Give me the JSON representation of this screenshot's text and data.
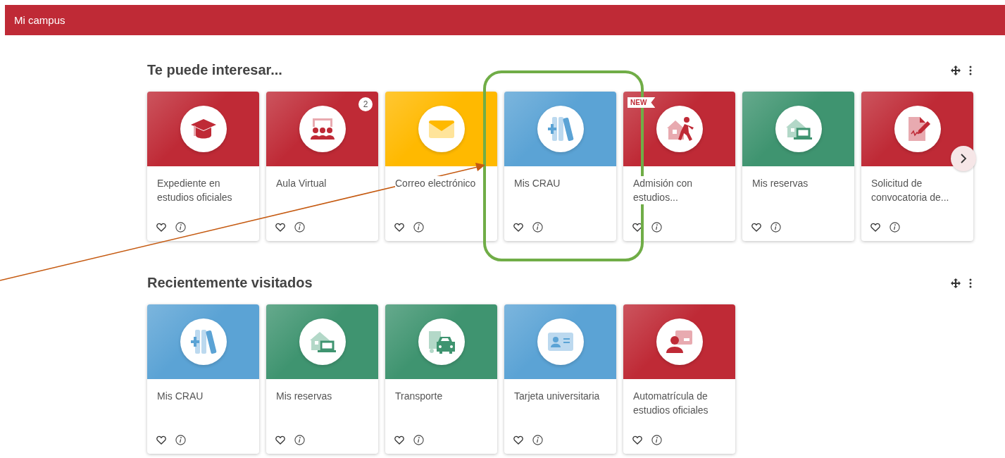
{
  "header": {
    "title": "Mi campus"
  },
  "sections": [
    {
      "title": "Te puede interesar...",
      "scrollable": true,
      "cards": [
        {
          "label": "Expediente en estudios oficiales",
          "color": "#bf2a36"
        },
        {
          "label": "Aula Virtual",
          "color": "#bf2a36",
          "badge": "2"
        },
        {
          "label": "Correo electrónico",
          "color": "#ffb900"
        },
        {
          "label": "Mis CRAU",
          "color": "#5ba3d5"
        },
        {
          "label": "Admisión con estudios...",
          "color": "#bf2a36",
          "tag": "NEW"
        },
        {
          "label": "Mis reservas",
          "color": "#3f9470"
        },
        {
          "label": "Solicitud de convocatoria de...",
          "color": "#bf2a36"
        }
      ]
    },
    {
      "title": "Recientemente visitados",
      "scrollable": false,
      "cards": [
        {
          "label": "Mis CRAU",
          "color": "#5ba3d5"
        },
        {
          "label": "Mis reservas",
          "color": "#3f9470"
        },
        {
          "label": "Transporte",
          "color": "#3f9470"
        },
        {
          "label": "Tarjeta universitaria",
          "color": "#5ba3d5"
        },
        {
          "label": "Automatrícula de estudios oficiales",
          "color": "#bf2a36"
        }
      ]
    }
  ],
  "annotations": [
    {
      "kind": "highlight",
      "color": "#70ad47"
    },
    {
      "kind": "arrow",
      "color": "#c55a11"
    }
  ]
}
